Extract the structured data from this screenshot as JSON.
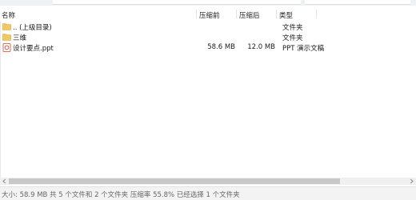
{
  "header": {
    "name": "名称",
    "size_before": "压缩前",
    "size_after": "压缩后",
    "type": "类型"
  },
  "rows": [
    {
      "icon": "folder-icon",
      "name": ".. (上级目录)",
      "size_before": "",
      "size_after": "",
      "type": "文件夹"
    },
    {
      "icon": "folder-icon",
      "name": "三维",
      "size_before": "",
      "size_after": "",
      "type": "文件夹"
    },
    {
      "icon": "ppt-file-icon",
      "name": "设计要点.ppt",
      "size_before": "58.6 MB",
      "size_after": "12.0 MB",
      "type": "PPT 演示文稿"
    }
  ],
  "status": {
    "text": "大小: 58.9 MB 共 5 个文件和 2 个文件夹 压缩率 55.8% 已经选择 1 个文件夹"
  },
  "colors": {
    "folder": "#f2c660",
    "ppt": "#d24726",
    "scroll_thumb": "#c8c8c8"
  }
}
